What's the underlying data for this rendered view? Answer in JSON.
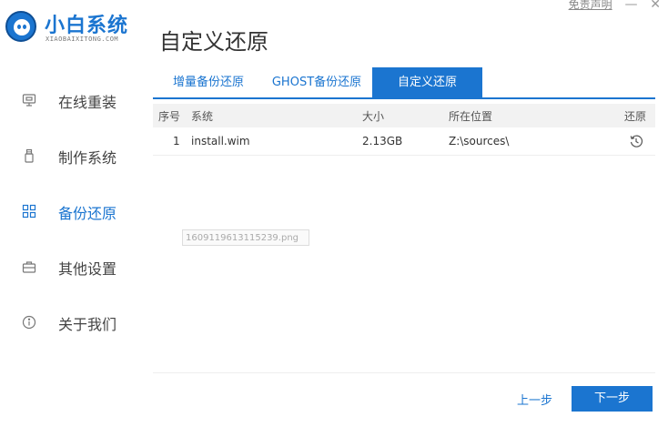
{
  "brand": {
    "title": "小白系统",
    "subtitle": "XIAOBAIXITONG.COM"
  },
  "page_title": "自定义还原",
  "top_links": {
    "disclaimer": "免责声明",
    "minimize": "—",
    "close": "✕"
  },
  "sidebar": {
    "items": [
      {
        "label": "在线重装",
        "icon": "monitor-icon",
        "active": false
      },
      {
        "label": "制作系统",
        "icon": "usb-icon",
        "active": false
      },
      {
        "label": "备份还原",
        "icon": "grid-icon",
        "active": true
      },
      {
        "label": "其他设置",
        "icon": "toolbox-icon",
        "active": false
      },
      {
        "label": "关于我们",
        "icon": "info-icon",
        "active": false
      }
    ]
  },
  "tabs": [
    {
      "label": "增量备份还原",
      "active": false
    },
    {
      "label": "GHOST备份还原",
      "active": false
    },
    {
      "label": "自定义还原",
      "active": true
    }
  ],
  "table": {
    "headers": {
      "index": "序号",
      "system": "系统",
      "size": "大小",
      "location": "所在位置",
      "restore": "还原"
    },
    "rows": [
      {
        "index": "1",
        "system": "install.wim",
        "size": "2.13GB",
        "location": "Z:\\sources\\",
        "restore_icon": "restore-icon"
      }
    ]
  },
  "tooltip": "1609119613115239.png",
  "footer": {
    "prev": "上一步",
    "next": "下一步"
  },
  "colors": {
    "accent": "#1b75d0",
    "header_bg": "#f2f2f2"
  }
}
